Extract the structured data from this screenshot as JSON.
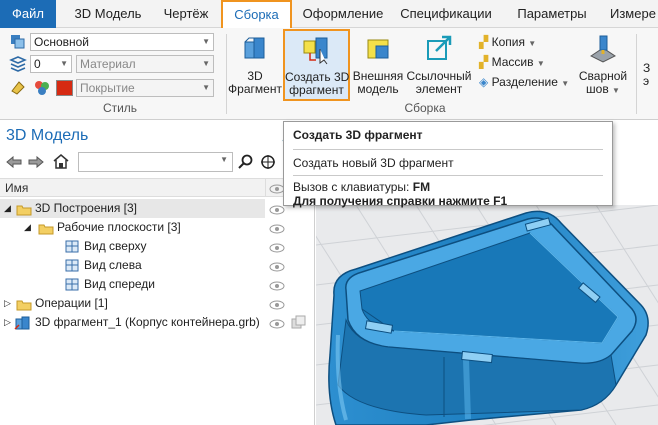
{
  "menu": {
    "file": "Файл",
    "tabs": [
      "3D Модель",
      "Чертёж",
      "Сборка",
      "Оформление",
      "Спецификации",
      "Параметры",
      "Измере"
    ]
  },
  "style_group": {
    "style_select": "Основной",
    "layer_value": "0",
    "material_placeholder": "Материал",
    "coating_placeholder": "Покрытие",
    "label": "Стиль",
    "color_swatch": "#d62a12"
  },
  "assembly_group": {
    "fragment_3d": "3D\nФрагмент",
    "create_fragment": "Создать 3D\nфрагмент",
    "external_model": "Внешняя\nмодель",
    "link_element": "Ссылочный\nэлемент",
    "copy": "Копия",
    "array": "Массив",
    "split": "Разделение",
    "weld": "Сварной\nшов",
    "label": "Сборка",
    "partial_next": "З\nэ"
  },
  "tooltip": {
    "title": "Создать 3D фрагмент",
    "description": "Создать новый 3D фрагмент",
    "shortcut_label": "Вызов с клавиатуры:",
    "shortcut_key": "FM",
    "help": "Для получения справки нажмите F1"
  },
  "panel": {
    "title": "3D Модель",
    "column_name": "Имя",
    "tree": [
      {
        "label": "3D Построения [3]"
      },
      {
        "label": "Рабочие плоскости [3]"
      },
      {
        "label": "Вид сверху"
      },
      {
        "label": "Вид слева"
      },
      {
        "label": "Вид спереди"
      },
      {
        "label": "Операции [1]"
      },
      {
        "label": "3D фрагмент_1 (Корпус контейнера.grb)"
      }
    ]
  },
  "colors": {
    "accent": "#1c6cb6",
    "highlight_border": "#f0941f",
    "model_blue": "#1e7fc0"
  }
}
